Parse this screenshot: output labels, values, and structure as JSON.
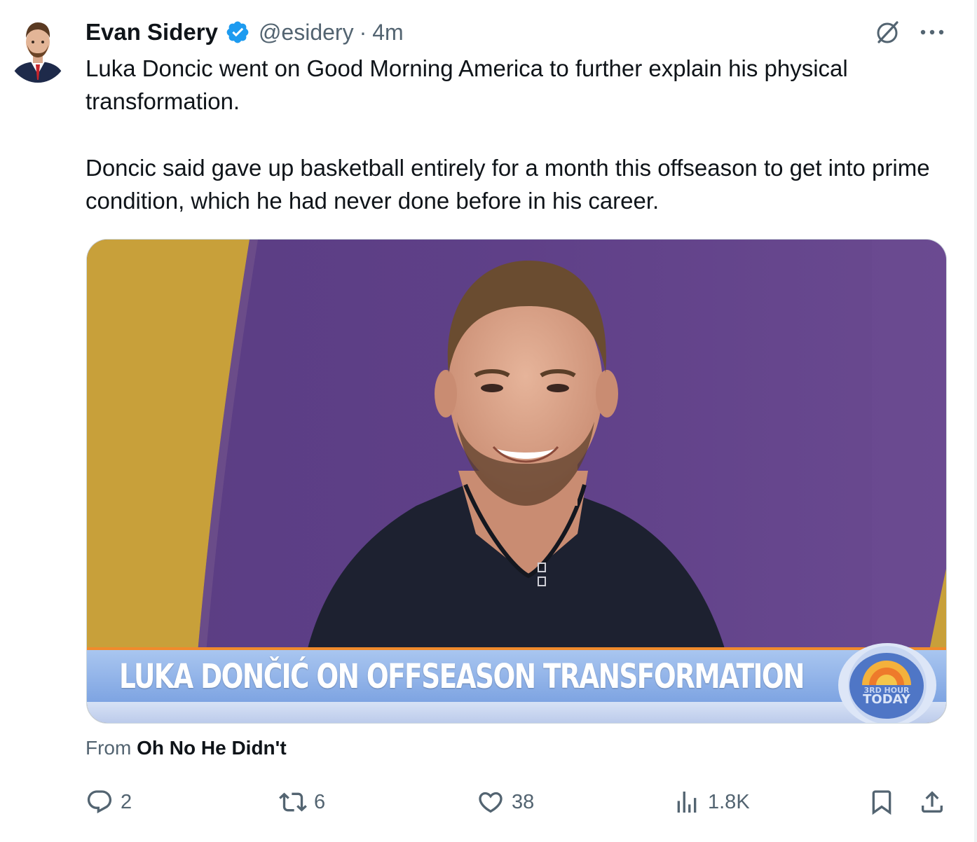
{
  "tweet": {
    "author_name": "Evan Sidery",
    "handle": "@esidery",
    "separator": "·",
    "time": "4m",
    "verified_badge_icon": "verified-badge-icon",
    "paragraph1": "Luka Doncic went on Good Morning America to further explain his physical transformation.",
    "paragraph2": "Doncic said gave up basketball entirely for a month this offseason to get into prime condition, which he had never done before in his career.",
    "media": {
      "chyron": "LUKA DONČIĆ ON OFFSEASON TRANSFORMATION",
      "logo_small": "3RD HOUR",
      "logo_text": "TODAY"
    },
    "source": {
      "prefix": "From",
      "name": "Oh No He Didn't"
    },
    "actions": {
      "replies": "2",
      "reposts": "6",
      "likes": "38",
      "views": "1.8K"
    }
  },
  "colors": {
    "accent_blue": "#1d9bf0",
    "secondary_text": "#536471",
    "primary_text": "#0f1419",
    "purple_backdrop": "#5e3f86",
    "gold_panel": "#c9a23c"
  },
  "icons": [
    "grok-icon",
    "more-icon",
    "reply-icon",
    "repost-icon",
    "like-icon",
    "views-icon",
    "bookmark-icon",
    "share-icon"
  ]
}
